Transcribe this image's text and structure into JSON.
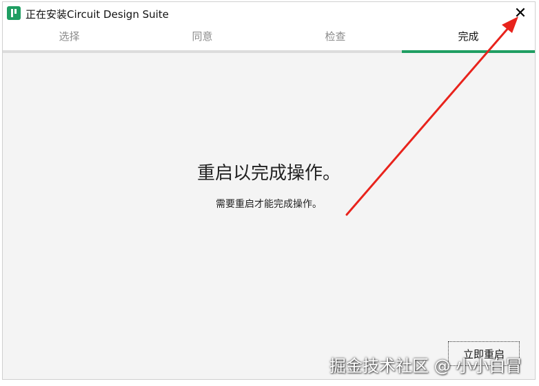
{
  "window": {
    "title": "正在安装Circuit Design Suite",
    "close_symbol": "✕"
  },
  "steps": [
    {
      "label": "选择",
      "state": "done"
    },
    {
      "label": "同意",
      "state": "done"
    },
    {
      "label": "检查",
      "state": "done"
    },
    {
      "label": "完成",
      "state": "active"
    }
  ],
  "content": {
    "heading": "重启以完成操作。",
    "message": "需要重启才能完成操作。"
  },
  "buttons": {
    "restart_now": "立即重启"
  },
  "watermark": {
    "text": "掘金技术社区 @ 小小白冒"
  },
  "colors": {
    "accent": "#1f9e62",
    "annotation_arrow": "#e8231c"
  },
  "icons": {
    "app": "app-logo-icon",
    "close": "close-icon"
  }
}
